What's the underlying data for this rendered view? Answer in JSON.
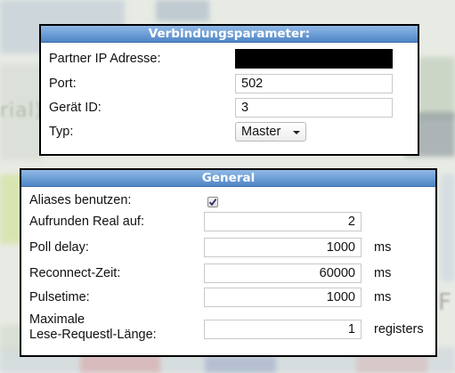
{
  "connection": {
    "title": "Verbindungsparameter:",
    "partner_ip_label": "Partner IP Adresse:",
    "partner_ip_value": "",
    "port_label": "Port:",
    "port_value": "502",
    "device_id_label": "Gerät ID:",
    "device_id_value": "3",
    "type_label": "Typ:",
    "type_value": "Master"
  },
  "general": {
    "title": "General",
    "aliases_label": "Aliases benutzen:",
    "aliases_checked": true,
    "round_real_label": "Aufrunden Real auf:",
    "round_real_value": "2",
    "poll_delay_label": "Poll delay:",
    "poll_delay_value": "1000",
    "poll_delay_unit": "ms",
    "reconnect_label": "Reconnect-Zeit:",
    "reconnect_value": "60000",
    "reconnect_unit": "ms",
    "pulsetime_label": "Pulsetime:",
    "pulsetime_value": "1000",
    "pulsetime_unit": "ms",
    "max_request_label_line1": "Maximale",
    "max_request_label_line2": "Lese-Requestl-Länge:",
    "max_request_value": "1",
    "max_request_unit": "registers"
  },
  "background": {
    "left_text": "rial)",
    "right_text": "F"
  },
  "colors": {
    "header_top": "#8fb8e6",
    "header_bottom": "#4f86c6",
    "panel_border": "#000000"
  }
}
